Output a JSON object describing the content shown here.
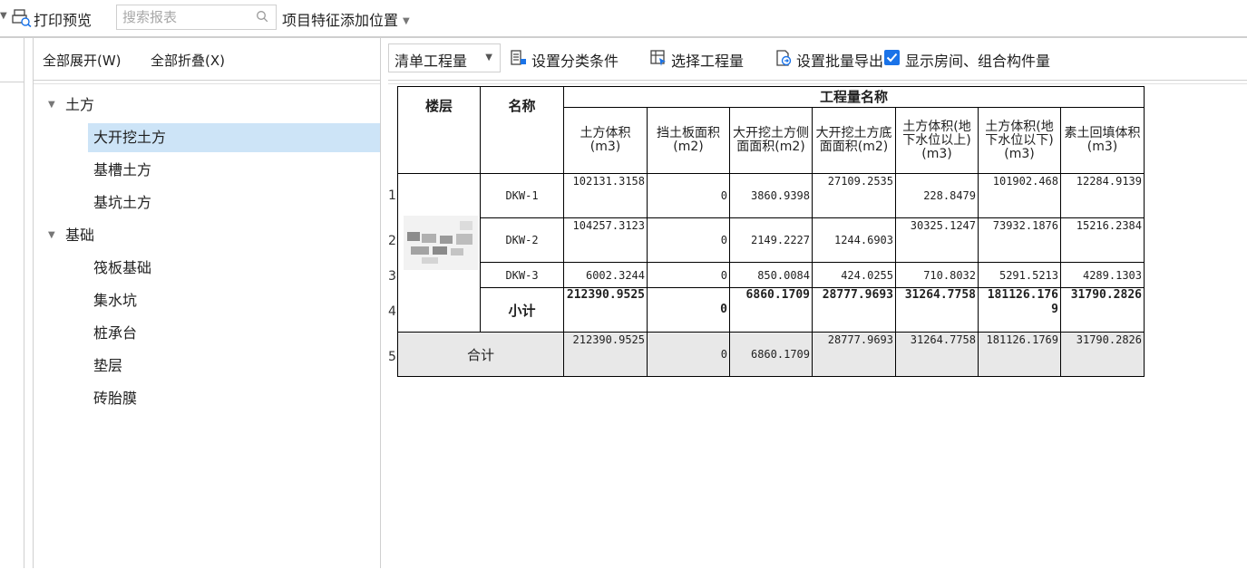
{
  "toolbar": {
    "print_preview": "打印预览",
    "search_placeholder": "搜索报表",
    "feature_position": "项目特征添加位置"
  },
  "tree": {
    "expand_all": "全部展开(W)",
    "collapse_all": "全部折叠(X)",
    "groups": [
      {
        "label": "土方",
        "items": [
          "大开挖土方",
          "基槽土方",
          "基坑土方"
        ]
      },
      {
        "label": "基础",
        "items": [
          "筏板基础",
          "集水坑",
          "桩承台",
          "垫层",
          "砖胎膜"
        ]
      }
    ],
    "selected": "大开挖土方"
  },
  "right_toolbar": {
    "quantity_type": "清单工程量",
    "set_category": "设置分类条件",
    "select_quantity": "选择工程量",
    "batch_export": "设置批量导出",
    "show_rooms": "显示房间、组合构件量",
    "show_rooms_checked": true
  },
  "table": {
    "header_floor": "楼层",
    "header_name": "名称",
    "header_group": "工程量名称",
    "columns": [
      "土方体积(m3)",
      "挡土板面积(m2)",
      "大开挖土方侧面面积(m2)",
      "大开挖土方底面面积(m2)",
      "土方体积(地下水位以上)(m3)",
      "土方体积(地下水位以下)(m3)",
      "素土回填体积(m3)"
    ],
    "row_numbers": [
      "1",
      "2",
      "3",
      "4",
      "5"
    ],
    "rows": [
      {
        "name": "DKW-1",
        "values": [
          "102131.3158",
          "0",
          "3860.9398",
          "27109.2535",
          "228.8479",
          "101902.468",
          "12284.9139"
        ]
      },
      {
        "name": "DKW-2",
        "values": [
          "104257.3123",
          "0",
          "2149.2227",
          "1244.6903",
          "30325.1247",
          "73932.1876",
          "15216.2384"
        ]
      },
      {
        "name": "DKW-3",
        "values": [
          "6002.3244",
          "0",
          "850.0084",
          "424.0255",
          "710.8032",
          "5291.5213",
          "4289.1303"
        ]
      }
    ],
    "subtotal": {
      "name": "小计",
      "values": [
        "212390.9525",
        "0",
        "6860.1709",
        "28777.9693",
        "31264.7758",
        "181126.1769",
        "31790.2826"
      ]
    },
    "total": {
      "name": "合计",
      "values": [
        "212390.9525",
        "0",
        "6860.1709",
        "28777.9693",
        "31264.7758",
        "181126.1769",
        "31790.2826"
      ]
    }
  }
}
